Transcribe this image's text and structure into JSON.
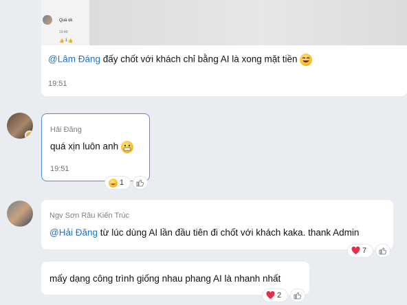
{
  "top_preview": {
    "quote_text": "Quá ok",
    "quote_time": "19:49",
    "quote_react_count": "1"
  },
  "msg1": {
    "mention": "@Lâm Đáng",
    "text": " đấy chốt với khách chỉ bằng AI là xong mặt tiền",
    "time": "19:51"
  },
  "msg2": {
    "sender": "Hải Đăng",
    "text": "quá xịn luôn anh",
    "time": "19:51",
    "react_count": "1"
  },
  "msg3": {
    "sender": "Ngv Sơn Râu Kiến Trúc",
    "mention": "@Hải Đăng",
    "text": " từ lúc dùng AI lần đầu tiên đi chốt với khách kaka. thank Admin",
    "react_count": "7"
  },
  "msg4": {
    "text": "mấy dạng công trình giống nhau phang AI là nhanh nhất",
    "react_count": "2"
  },
  "colors": {
    "mention": "#1a73c8",
    "selected_border": "#4a8fd9",
    "heart": "#e0304a"
  },
  "icons": [
    "laughing-emoji-icon",
    "grinning-emoji-icon",
    "heart-icon",
    "thumbs-up-icon"
  ]
}
